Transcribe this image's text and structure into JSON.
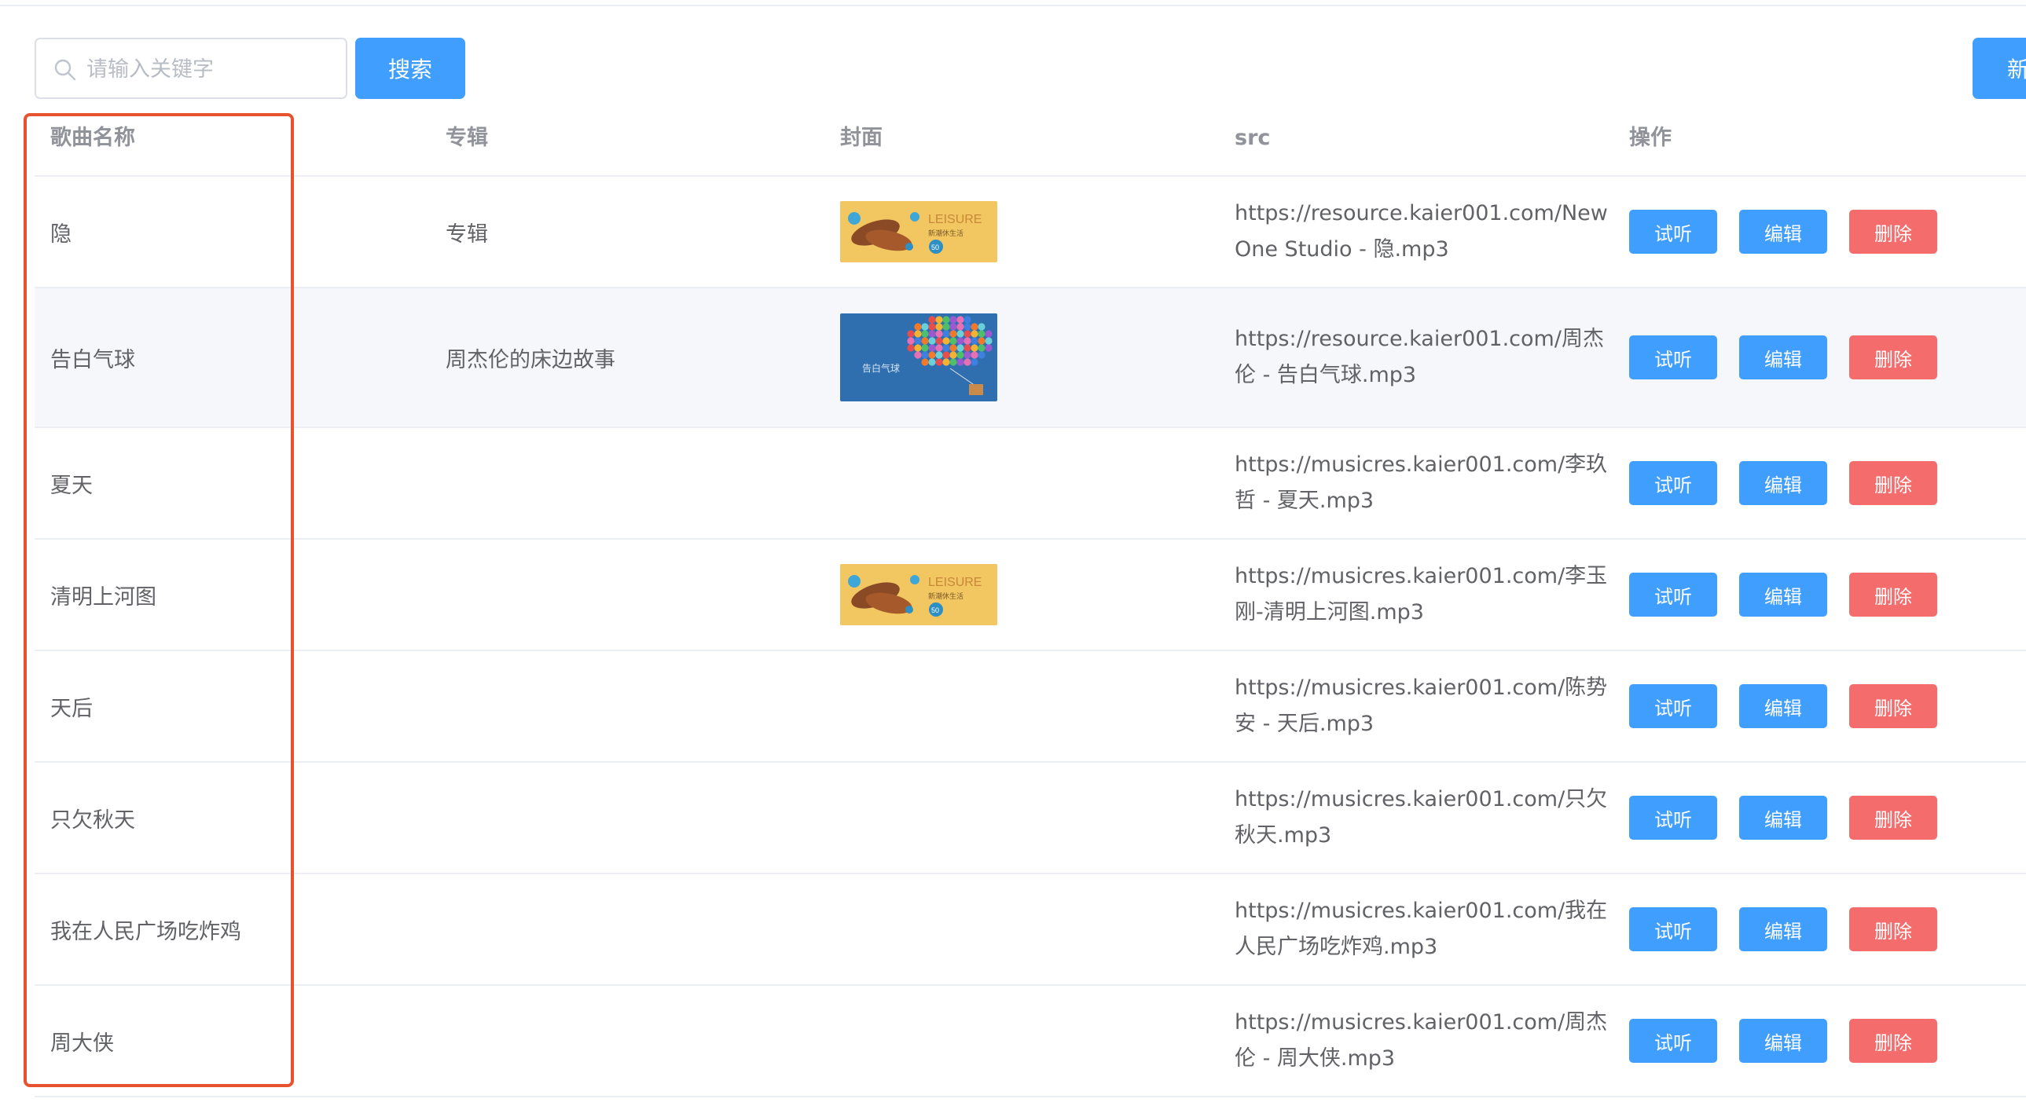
{
  "search": {
    "placeholder": "请输入关键字",
    "button_label": "搜索"
  },
  "new_button_label": "新",
  "table": {
    "headers": {
      "name": "歌曲名称",
      "album": "专辑",
      "cover": "封面",
      "src": "src",
      "ops": "操作"
    },
    "ops_labels": {
      "listen": "试听",
      "edit": "编辑",
      "delete": "删除"
    },
    "rows": [
      {
        "name": "隐",
        "album": "专辑",
        "cover": "leisure",
        "src": "https://resource.kaier001.com/New One Studio - 隐.mp3"
      },
      {
        "name": "告白气球",
        "album": "周杰伦的床边故事",
        "cover": "balloon",
        "src": "https://resource.kaier001.com/周杰伦 - 告白气球.mp3"
      },
      {
        "name": "夏天",
        "album": "",
        "cover": "",
        "src": "https://musicres.kaier001.com/李玖哲 - 夏天.mp3"
      },
      {
        "name": "清明上河图",
        "album": "",
        "cover": "leisure",
        "src": "https://musicres.kaier001.com/李玉刚-清明上河图.mp3"
      },
      {
        "name": "天后",
        "album": "",
        "cover": "",
        "src": "https://musicres.kaier001.com/陈势安 - 天后.mp3"
      },
      {
        "name": "只欠秋天",
        "album": "",
        "cover": "",
        "src": "https://musicres.kaier001.com/只欠秋天.mp3"
      },
      {
        "name": "我在人民广场吃炸鸡",
        "album": "",
        "cover": "",
        "src": "https://musicres.kaier001.com/我在人民广场吃炸鸡.mp3"
      },
      {
        "name": "周大侠",
        "album": "",
        "cover": "",
        "src": "https://musicres.kaier001.com/周杰伦 - 周大侠.mp3"
      }
    ]
  },
  "covers": {
    "leisure": {
      "title": "LEISURE",
      "subtitle": "新潮休生活",
      "badge": "50"
    },
    "balloon": {
      "text": "告白气球"
    }
  },
  "colors": {
    "primary": "#409eff",
    "danger": "#f56c6c",
    "highlight": "#e8532f"
  }
}
